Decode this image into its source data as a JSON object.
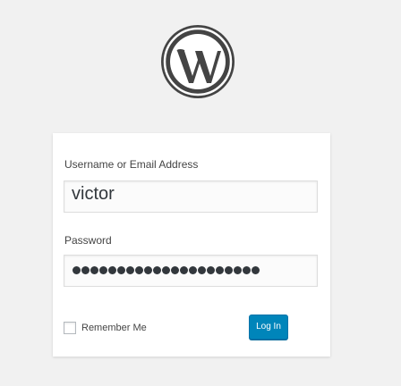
{
  "logo": {
    "icon": "wordpress-logo-icon",
    "color": "#444444"
  },
  "form": {
    "username_label": "Username or Email Address",
    "username_value": "victor",
    "password_label": "Password",
    "password_masked_length": 21,
    "remember_label": "Remember Me",
    "remember_checked": false,
    "submit_label": "Log In"
  },
  "colors": {
    "page_bg": "#f1f1f1",
    "card_bg": "#ffffff",
    "accent": "#0085ba"
  }
}
